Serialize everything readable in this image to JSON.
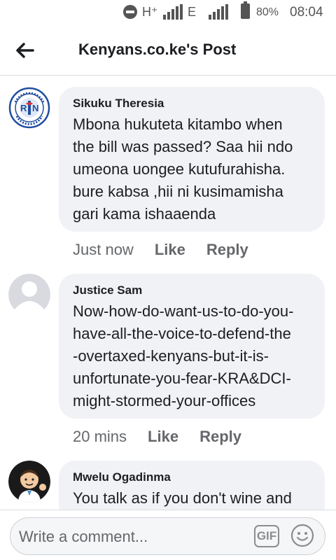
{
  "status_bar": {
    "network_1": "H⁺",
    "network_2": "E",
    "battery": "80%",
    "time": "08:04"
  },
  "header": {
    "title": "Kenyans.co.ke's Post",
    "back_icon": "arrow-left-icon"
  },
  "comments": [
    {
      "author": "Sikuku Theresia",
      "avatar_icon": "registered-nurse-badge",
      "text": "Mbona hukuteta kitambo when\nthe bill was passed? Saa hii ndo\numeona uongee kutufurahisha.\nbure kabsa ,hii ni kusimamisha\ngari kama ishaaenda",
      "time": "Just now",
      "like": "Like",
      "reply": "Reply"
    },
    {
      "author": "Justice Sam",
      "avatar_icon": "default-user-avatar",
      "text": "Now-how-do-want-us-to-do-you-\nhave-all-the-voice-to-defend-the\n-overtaxed-kenyans-but-it-is-\nunfortunate-you-fear-KRA&DCI-\nmight-stormed-your-offices",
      "time": "20 mins",
      "like": "Like",
      "reply": "Reply"
    },
    {
      "author": "Mwelu Ogadinma",
      "avatar_icon": "doctor-emoji-avatar",
      "text": "You talk as if you don't wine and"
    }
  ],
  "composer": {
    "placeholder": "Write a comment...",
    "gif_label": "GIF",
    "emoji_icon": "smiley-icon"
  },
  "colors": {
    "bubble": "#f0f2f5",
    "meta_text": "#65676b",
    "nurse_badge": "#1f4e9e"
  }
}
